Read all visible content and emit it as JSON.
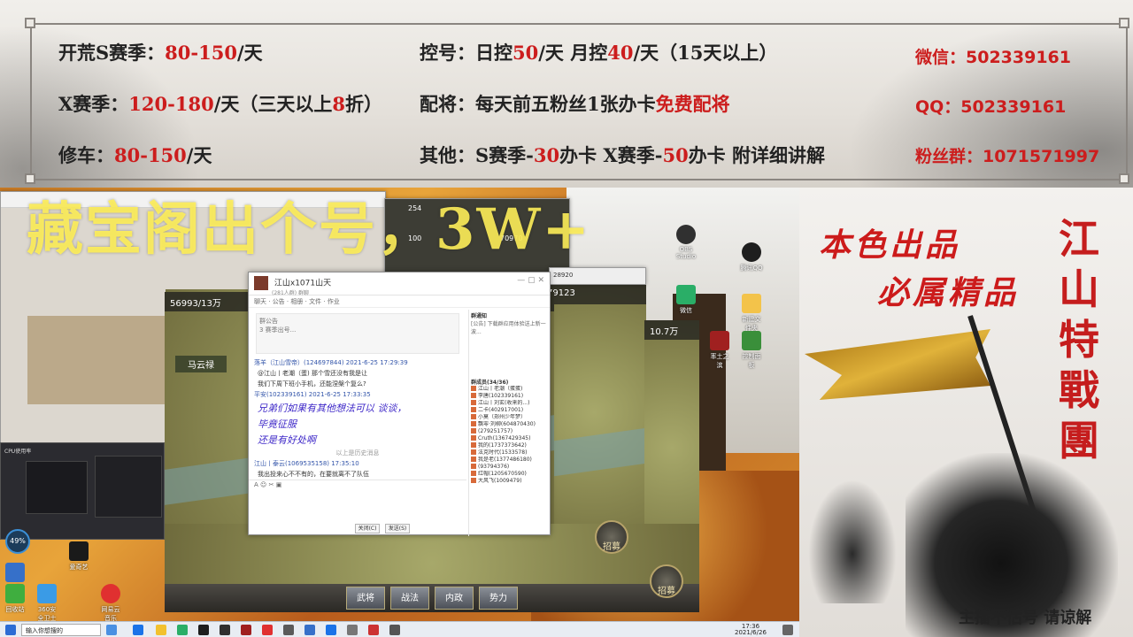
{
  "banner": {
    "r1a_label": "开荒S赛季：",
    "r1a_price": "80-150",
    "r1a_unit": "/天",
    "r1b_label": "控号：日控",
    "r1b_n1": "50",
    "r1b_mid": "/天 月控",
    "r1b_n2": "40",
    "r1b_tail": "/天（15天以上）",
    "r2a_label": "X赛季：",
    "r2a_price": "120-180",
    "r2a_unit": "/天（三天以上",
    "r2a_n": "8",
    "r2a_tail": "折）",
    "r2b_label": "配将：每天前五粉丝1张办卡",
    "r2b_free": "免费配将",
    "r3a_label": "修车：",
    "r3a_price": "80-150",
    "r3a_unit": "/天",
    "r3b_label": "其他：S赛季-",
    "r3b_n1": "30",
    "r3b_mid": "办卡 X赛季-",
    "r3b_n2": "50",
    "r3b_tail": "办卡 附详细讲解",
    "wechat": "微信：502339161",
    "qq": "QQ：502339161",
    "fans": "粉丝群：1071571997"
  },
  "overlay_title": "藏宝阁出个号，3W+",
  "chat": {
    "window_title": "江山x1071山天",
    "member_count": "(281人群) 群聊",
    "tabs": [
      "聊天",
      "公告",
      "相册",
      "文件",
      "作业"
    ],
    "notice_title": "群公告",
    "notice_text": "3 赛季出号...",
    "msg1_user": "落羊（江山雪帝）(124697844) 2021-6-25 17:29:39",
    "msg1_text": "@江山丨老潮（蛋)  那个雪还没有我是让",
    "msg2_text": "我们下周下班小手机，还能涅槃个复么?",
    "msg3_user": "平安(102339161)  2021-6-25 17:33:35",
    "hand1": "兄弟们如果有其他想法可以 谈谈，",
    "hand2": "毕竟征服",
    "hand3": "还是有好处啊",
    "history": "以上是历史消息",
    "msg4_user": "江山丨泰云(1069535158)  17:35:10",
    "msg4_text": "我出投来心不不有的，在要就离不了队伍",
    "close_btn": "关闭(C)",
    "send_btn": "发送(S)",
    "right_title": "群通知",
    "right_notice": "[公告] 下载群应用体验送上新一波...",
    "right_members_title": "群成员(34/36)",
    "members": [
      "江山丨老潮（蛋蛋)",
      "李唐(102339161)",
      "江山丨刘玄(收来的...)",
      "二卡(402917001)",
      "小莫（郑州少年梦）",
      "飘零·刘柳(604870430)",
      "(279251757)",
      "Cruth(1367429345)",
      "我的(1737373642)",
      "法克时代(1533578)",
      "我是老(1377486180)",
      "(93794376)",
      "红帽(1205670590)",
      "大风飞(1009479)"
    ]
  },
  "game": {
    "hud_res": "56993/13万",
    "hero": "马云禄",
    "btns": [
      "武将",
      "战法",
      "内政",
      "势力"
    ],
    "recruit": "招募",
    "res2": "10.7万",
    "res3": "79123",
    "res4": "254",
    "res5": "100",
    "res6": "70970",
    "res7": "28920"
  },
  "desktop_icons": [
    {
      "label": "OBS Studio"
    },
    {
      "label": "微信"
    },
    {
      "label": "腾讯QQ"
    },
    {
      "label": "新建文件夹"
    },
    {
      "label": "率土之滨"
    },
    {
      "label": "控制面板"
    },
    {
      "label": "迅雷"
    },
    {
      "label": "爱奇艺"
    },
    {
      "label": "回收站"
    },
    {
      "label": "360安全卫士"
    },
    {
      "label": "网易云音乐"
    }
  ],
  "promo": {
    "line1": "本色出品",
    "line2": "必属精品",
    "vertical": [
      "江",
      "山",
      "特",
      "戰",
      "團"
    ],
    "bottom": "主播不估号 请谅解"
  },
  "taskbar": {
    "start": "",
    "search": "输入你想搜的",
    "clock_time": "17:36",
    "clock_date": "2021/6/26",
    "items": [
      "文件夹",
      "浏览器",
      "QQ",
      "微信",
      "OBS"
    ]
  },
  "obs": {
    "cpu": "49%",
    "status": "CPU使用率"
  },
  "colors": {
    "red": "#cc1d1d",
    "overlay_yellow": "#fff05a",
    "handwriting": "#3e28c8"
  }
}
